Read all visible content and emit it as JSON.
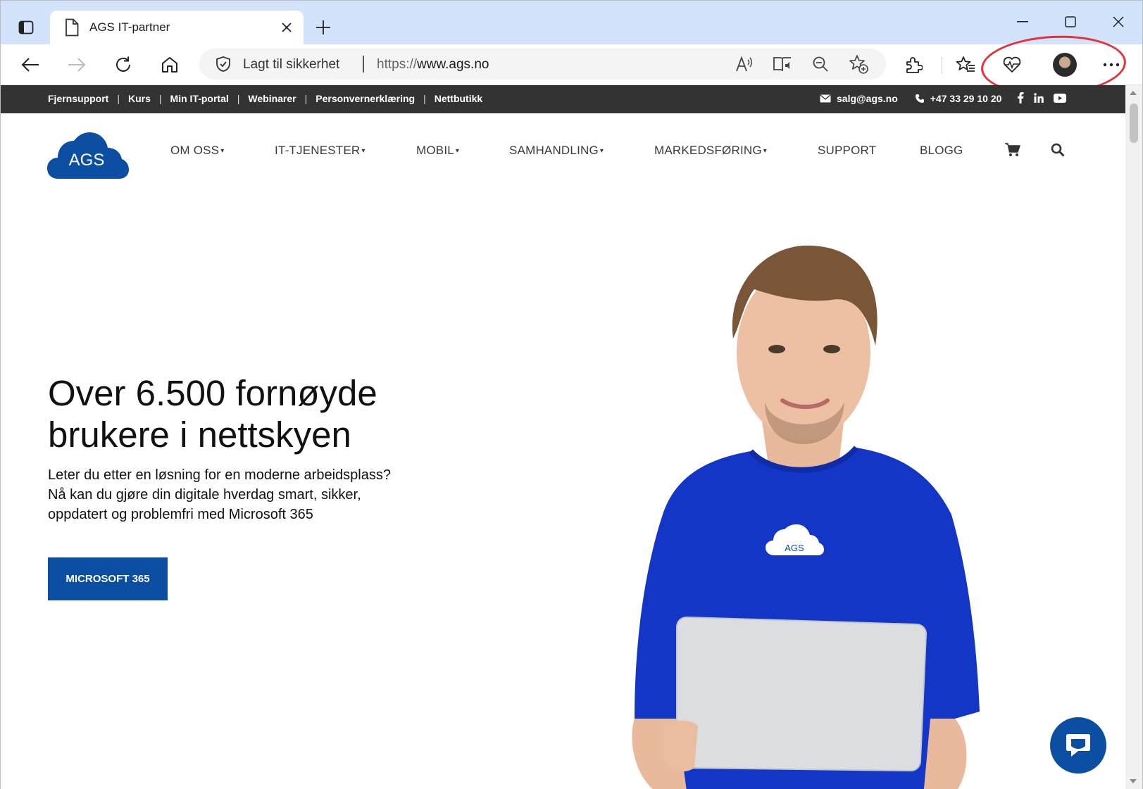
{
  "browser": {
    "tab": {
      "title": "AGS IT-partner"
    },
    "address_bar": {
      "security_label": "Lagt til sikkerhet",
      "url_scheme": "https://",
      "url_host": "www.ags.no"
    }
  },
  "site": {
    "topbar": {
      "links": [
        "Fjernsupport",
        "Kurs",
        "Min IT-portal",
        "Webinarer",
        "Personvernerklæring",
        "Nettbutikk"
      ],
      "email": "salg@ags.no",
      "phone": "+47 33 29 10 20"
    },
    "logo_text": "AGS",
    "nav": {
      "items": [
        {
          "label": "OM OSS",
          "has_dropdown": true
        },
        {
          "label": "IT-TJENESTER",
          "has_dropdown": true
        },
        {
          "label": "MOBIL",
          "has_dropdown": true
        },
        {
          "label": "SAMHANDLING",
          "has_dropdown": true
        },
        {
          "label": "MARKEDSFØRING",
          "has_dropdown": true
        },
        {
          "label": "SUPPORT",
          "has_dropdown": false
        },
        {
          "label": "BLOGG",
          "has_dropdown": false
        }
      ],
      "caret": "▾"
    },
    "hero": {
      "heading_line1": "Over 6.500 fornøyde",
      "heading_line2": "brukere i nettskyen",
      "body_line1": "Leter du etter en løsning for en moderne arbeidsplass?",
      "body_line2": "Nå kan du gjøre din digitale hverdag smart, sikker,",
      "body_line3": "oppdatert og problemfri med Microsoft 365",
      "cta_label": "MICROSOFT 365",
      "shirt_logo_text": "AGS"
    }
  },
  "colors": {
    "brand_blue": "#0b4ea2",
    "topbar_bg": "#333333",
    "annotation_red": "#e0333a"
  }
}
